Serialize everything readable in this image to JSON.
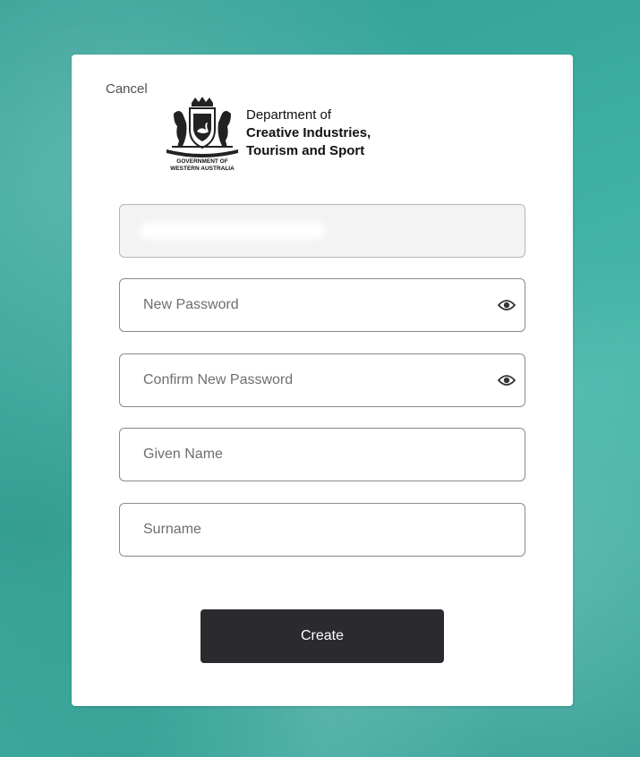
{
  "header": {
    "cancel_label": "Cancel"
  },
  "logo": {
    "government_line1": "GOVERNMENT OF",
    "government_line2": "WESTERN AUSTRALIA",
    "department_line1": "Department of",
    "department_line2": "Creative Industries,",
    "department_line3": "Tourism and Sport"
  },
  "form": {
    "email_placeholder": "",
    "new_password_placeholder": "New Password",
    "confirm_password_placeholder": "Confirm New Password",
    "given_name_placeholder": "Given Name",
    "surname_placeholder": "Surname",
    "create_label": "Create"
  },
  "icons": {
    "password_toggle": "eye-icon"
  },
  "colors": {
    "background": "#3fb0a5",
    "button": "#2b2b2f",
    "card": "#ffffff"
  }
}
